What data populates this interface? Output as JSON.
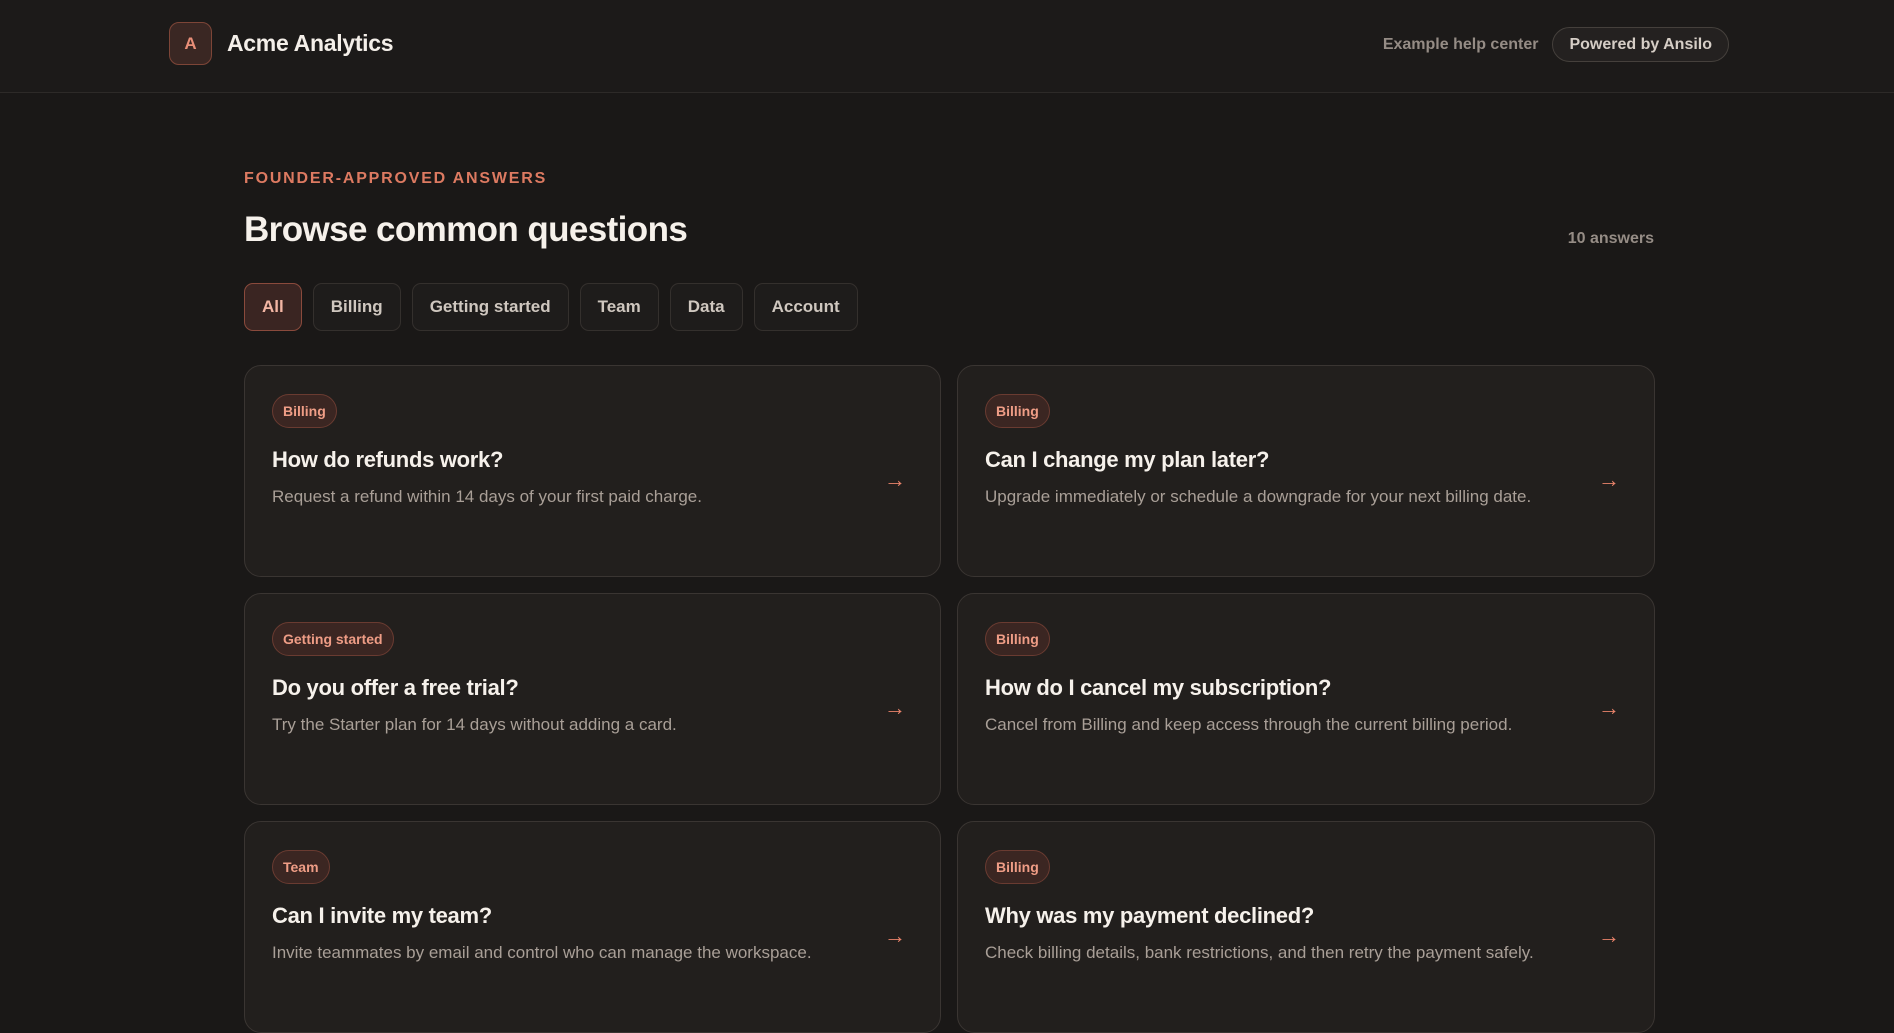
{
  "header": {
    "logo_letter": "A",
    "brand_name": "Acme Analytics",
    "help_link": "Example help center",
    "powered_by": "Powered by Ansilo"
  },
  "hero": {
    "eyebrow": "FOUNDER-APPROVED ANSWERS",
    "title": "Browse common questions",
    "count": "10 answers"
  },
  "filters": [
    {
      "label": "All",
      "active": true
    },
    {
      "label": "Billing",
      "active": false
    },
    {
      "label": "Getting started",
      "active": false
    },
    {
      "label": "Team",
      "active": false
    },
    {
      "label": "Data",
      "active": false
    },
    {
      "label": "Account",
      "active": false
    }
  ],
  "cards": [
    {
      "tag": "Billing",
      "question": "How do refunds work?",
      "answer": "Request a refund within 14 days of your first paid charge.",
      "arrow": "→"
    },
    {
      "tag": "Billing",
      "question": "Can I change my plan later?",
      "answer": "Upgrade immediately or schedule a downgrade for your next billing date.",
      "arrow": "→"
    },
    {
      "tag": "Getting started",
      "question": "Do you offer a free trial?",
      "answer": "Try the Starter plan for 14 days without adding a card.",
      "arrow": "→"
    },
    {
      "tag": "Billing",
      "question": "How do I cancel my subscription?",
      "answer": "Cancel from Billing and keep access through the current billing period.",
      "arrow": "→"
    },
    {
      "tag": "Team",
      "question": "Can I invite my team?",
      "answer": "Invite teammates by email and control who can manage the workspace.",
      "arrow": "→"
    },
    {
      "tag": "Billing",
      "question": "Why was my payment declined?",
      "answer": "Check billing details, bank restrictions, and then retry the payment safely.",
      "arrow": "→"
    }
  ],
  "colors": {
    "background": "#1a1817",
    "accent": "#dd7a61",
    "card": "#221f1d"
  },
  "icons": {
    "card_arrow": "arrow-right-icon"
  }
}
